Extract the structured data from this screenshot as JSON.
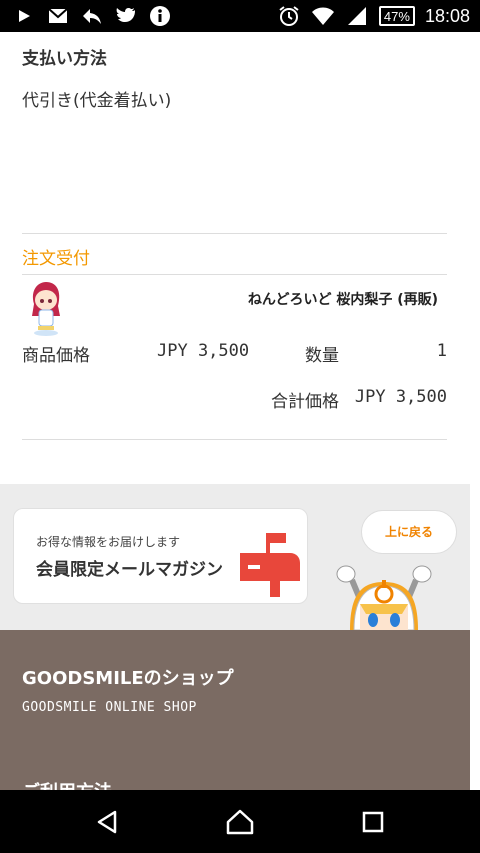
{
  "status_bar": {
    "icons_left": [
      "play-icon",
      "gmail-icon",
      "reply-icon",
      "twitter-icon",
      "info-icon"
    ],
    "battery": "47%",
    "time": "18:08"
  },
  "payment": {
    "title": "支払い方法",
    "value": "代引き(代金着払い)"
  },
  "order": {
    "title": "注文受付",
    "product_name": "ねんどろいど 桜内梨子 (再販)",
    "price_label": "商品価格",
    "price_value": "JPY 3,500",
    "qty_label": "数量",
    "qty_value": "1",
    "total_label": "合計価格",
    "total_value": "JPY 3,500"
  },
  "banner": {
    "mail_small": "お得な情報をお届けします",
    "mail_big": "会員限定メールマガジン",
    "back_to_top": "上に戻る"
  },
  "footer": {
    "shop_title": "GOODSMILEのショップ",
    "shop_sub": "GOODSMILE ONLINE SHOP",
    "next_title": "ご利用方法"
  },
  "colors": {
    "accent": "#f39800",
    "footer_bg": "#7b6b63",
    "mailbox_red": "#e8473b"
  }
}
